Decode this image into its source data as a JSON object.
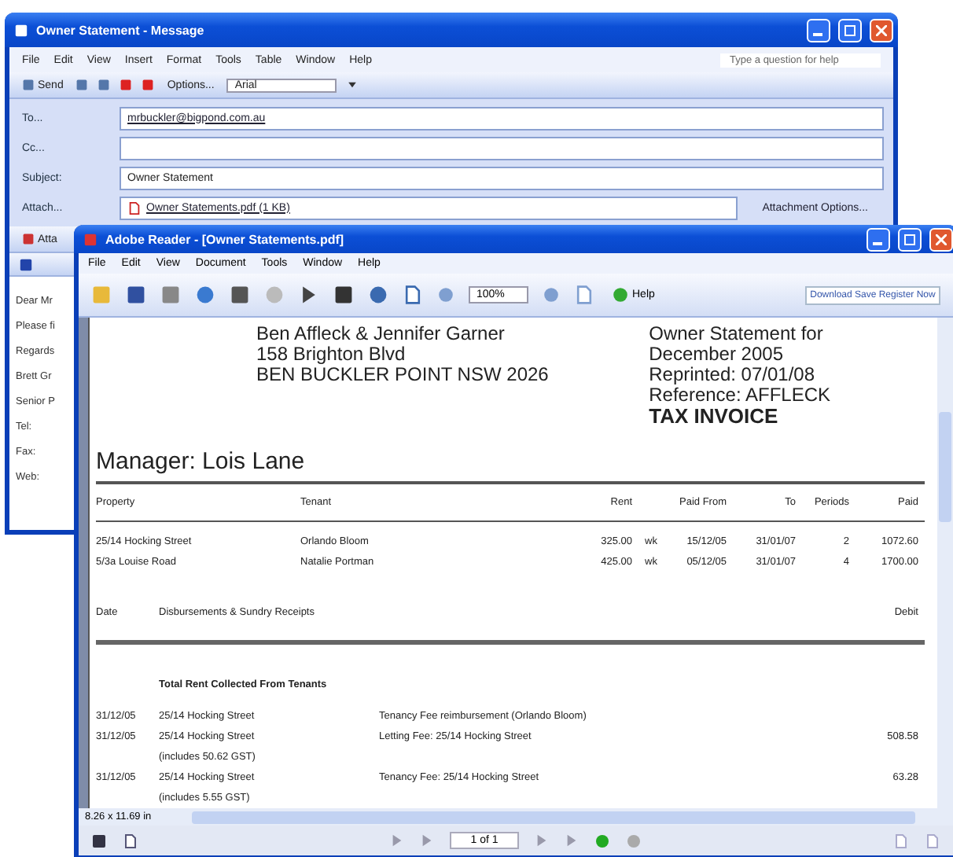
{
  "outlook": {
    "title": "Owner Statement - Message",
    "menu": [
      "File",
      "Edit",
      "View",
      "Insert",
      "Format",
      "Tools",
      "Table",
      "Window",
      "Help"
    ],
    "help_placeholder": "Type a question for help",
    "toolbar": {
      "send": "Send",
      "options": "Options...",
      "font": "Arial"
    },
    "fields": [
      {
        "label": "To...",
        "value": "mrbuckler@bigpond.com.au",
        "kind": "link"
      },
      {
        "label": "Cc...",
        "kind": "text"
      },
      {
        "label": "Subject:",
        "value": "Owner Statement",
        "kind": "text"
      },
      {
        "label": "Attach...",
        "value": "Owner Statements.pdf (1 KB)",
        "kind": "file"
      }
    ],
    "attachment_options": "Attachment Options...",
    "toolbar2": "Atta",
    "body_lines": [
      "Dear Mr",
      "Please fi",
      "Regards",
      "Brett Gr",
      "Senior P",
      "Tel:",
      "Fax:",
      "Web:"
    ]
  },
  "reader": {
    "title": "Adobe Reader - [Owner Statements.pdf]",
    "menu": [
      "File",
      "Edit",
      "View",
      "Document",
      "Tools",
      "Window",
      "Help"
    ],
    "zoom": "100%",
    "help": "Help",
    "banner": "Download Save Register Now",
    "document": {
      "addressee": [
        "Ben Affleck & Jennifer Garner",
        "158 Brighton Blvd",
        "BEN BUCKLER POINT NSW 2026"
      ],
      "statement": [
        "Owner Statement for",
        "December 2005",
        "Reprinted: 07/01/08",
        "Reference: AFFLECK"
      ],
      "invoice_label": "TAX INVOICE",
      "manager": "Manager: Lois Lane",
      "columns": [
        "Property",
        "Tenant",
        "Rent",
        "",
        "Paid From",
        "To",
        "Periods",
        "Paid"
      ],
      "rows": [
        [
          "25/14 Hocking Street",
          "Orlando Bloom",
          "325.00",
          "wk",
          "15/12/05",
          "31/01/07",
          "2",
          "1072.60"
        ],
        [
          "5/3a Louise Road",
          "Natalie Portman",
          "425.00",
          "wk",
          "05/12/05",
          "31/01/07",
          "4",
          "1700.00"
        ]
      ],
      "sundry_columns": [
        "Date",
        "Disbursements & Sundry Receipts",
        "Debit"
      ],
      "section_title": "Total Rent Collected From Tenants",
      "entries": [
        {
          "date": "31/12/05",
          "property": "25/14 Hocking Street",
          "description": "Tenancy Fee reimbursement (Orlando Bloom)"
        },
        {
          "date": "31/12/05",
          "property": "25/14 Hocking Street",
          "description": "Letting Fee: 25/14 Hocking Street",
          "debit": "508.58",
          "note": "(includes 50.62 GST)"
        },
        {
          "date": "31/12/05",
          "property": "25/14 Hocking Street",
          "description": "Tenancy Fee: 25/14 Hocking Street",
          "debit": "63.28",
          "note": "(includes 5.55 GST)"
        }
      ]
    },
    "page_size": "8.26 x 11.69 in",
    "page": "1 of 1"
  }
}
